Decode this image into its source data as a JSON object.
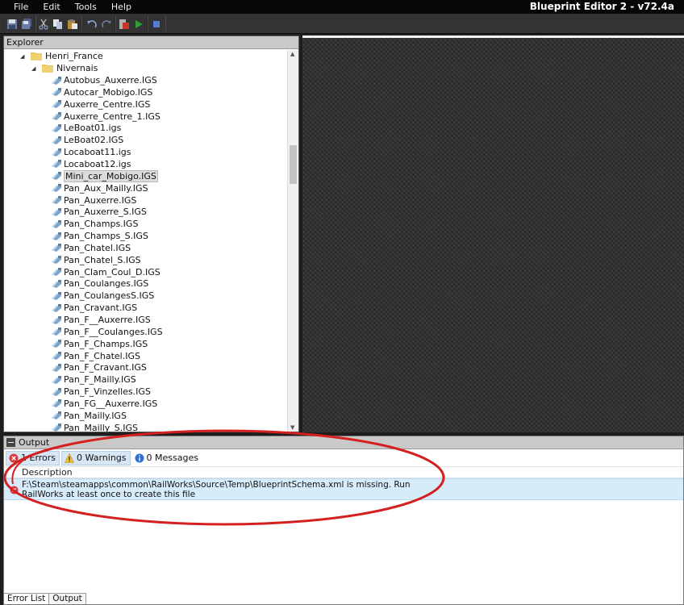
{
  "menu": [
    "File",
    "Edit",
    "Tools",
    "Help"
  ],
  "app_title": "Blueprint Editor 2 - v72.4a",
  "toolbar_icons": [
    "save-icon",
    "save-all-icon",
    "cut-icon",
    "copy-icon",
    "paste-icon",
    "undo-icon",
    "redo-icon",
    "export-icon",
    "run-icon",
    "stop-icon"
  ],
  "explorer": {
    "title": "Explorer",
    "folders": [
      "Henri_France",
      "Nivernais"
    ],
    "selected": "Mini_car_Mobigo.IGS",
    "files": [
      "Autobus_Auxerre.IGS",
      "Autocar_Mobigo.IGS",
      "Auxerre_Centre.IGS",
      "Auxerre_Centre_1.IGS",
      "LeBoat01.igs",
      "LeBoat02.IGS",
      "Locaboat11.igs",
      "Locaboat12.igs",
      "Mini_car_Mobigo.IGS",
      "Pan_Aux_Mailly.IGS",
      "Pan_Auxerre.IGS",
      "Pan_Auxerre_S.IGS",
      "Pan_Champs.IGS",
      "Pan_Champs_S.IGS",
      "Pan_Chatel.IGS",
      "Pan_Chatel_S.IGS",
      "Pan_Clam_Coul_D.IGS",
      "Pan_Coulanges.IGS",
      "Pan_CoulangesS.IGS",
      "Pan_Cravant.IGS",
      "Pan_F__Auxerre.IGS",
      "Pan_F__Coulanges.IGS",
      "Pan_F_Champs.IGS",
      "Pan_F_Chatel.IGS",
      "Pan_F_Cravant.IGS",
      "Pan_F_Mailly.IGS",
      "Pan_F_Vinzelles.IGS",
      "Pan_FG__Auxerre.IGS",
      "Pan_Mailly.IGS",
      "Pan_Mailly_S.IGS"
    ]
  },
  "output": {
    "title": "Output",
    "filters": {
      "errors": "1 Errors",
      "warnings": "0 Warnings",
      "messages": "0 Messages"
    },
    "column": "Description",
    "errors": [
      "F:\\Steam\\steamapps\\common\\RailWorks\\Source\\Temp\\BlueprintSchema.xml is missing. Run RailWorks at least once to create this file"
    ],
    "tabs": [
      "Error List",
      "Output"
    ]
  },
  "colors": {
    "titlebar": "#060606",
    "toolbar": "#333333",
    "panel_header": "#c9c9c9",
    "selection": "#d7ecfa",
    "annotation": "#d42020"
  }
}
